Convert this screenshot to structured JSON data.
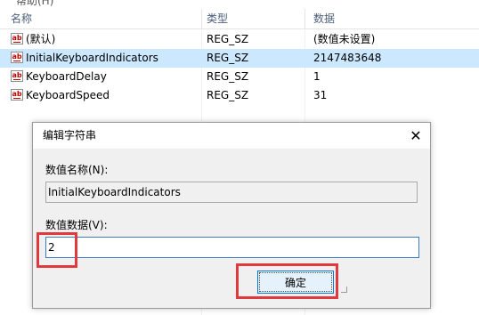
{
  "menu": {
    "help": "帮助(H)"
  },
  "columns": {
    "name": "名称",
    "type": "类型",
    "data": "数据"
  },
  "rows": [
    {
      "name": "(默认)",
      "type": "REG_SZ",
      "data": "(数值未设置)",
      "selected": false
    },
    {
      "name": "InitialKeyboardIndicators",
      "type": "REG_SZ",
      "data": "2147483648",
      "selected": true
    },
    {
      "name": "KeyboardDelay",
      "type": "REG_SZ",
      "data": "1",
      "selected": false
    },
    {
      "name": "KeyboardSpeed",
      "type": "REG_SZ",
      "data": "31",
      "selected": false
    }
  ],
  "icons": {
    "value": "ab",
    "close": "✕"
  },
  "dialog": {
    "title": "编辑字符串",
    "close_label": "✕",
    "name_label": "数值名称(N):",
    "name_value": "InitialKeyboardIndicators",
    "data_label": "数值数据(V):",
    "data_value": "2",
    "ok_label": "确定"
  },
  "colors": {
    "selection": "#cce8ff",
    "highlight": "#e0393e",
    "accent": "#0078d7"
  }
}
